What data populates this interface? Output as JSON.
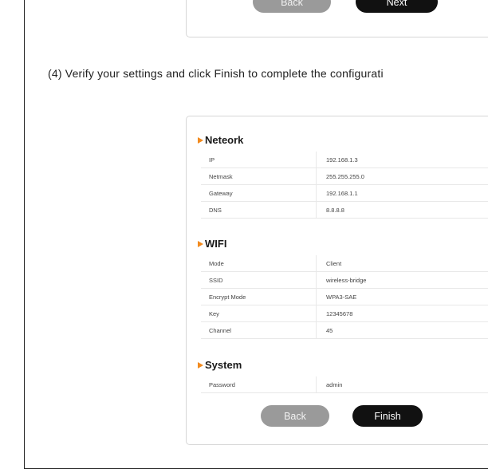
{
  "top_card": {
    "back_label": "Back",
    "next_label": "Next"
  },
  "instruction": "(4) Verify your settings and click Finish to complete the configurati",
  "network": {
    "title": "Neteork",
    "rows": [
      {
        "label": "IP",
        "value": "192.168.1.3"
      },
      {
        "label": "Netmask",
        "value": "255.255.255.0"
      },
      {
        "label": "Gateway",
        "value": "192.168.1.1"
      },
      {
        "label": "DNS",
        "value": "8.8.8.8"
      }
    ]
  },
  "wifi": {
    "title": "WIFI",
    "rows": [
      {
        "label": "Mode",
        "value": "Client"
      },
      {
        "label": "SSID",
        "value": "wireless-bridge"
      },
      {
        "label": "Encrypt Mode",
        "value": "WPA3-SAE"
      },
      {
        "label": "Key",
        "value": "12345678"
      },
      {
        "label": "Channel",
        "value": "45"
      }
    ]
  },
  "system": {
    "title": "System",
    "rows": [
      {
        "label": "Password",
        "value": "admin"
      }
    ]
  },
  "buttons": {
    "back_label": "Back",
    "finish_label": "Finish"
  },
  "colors": {
    "section_marker": "#f28a1e",
    "primary_button": "#111111",
    "secondary_button": "#9a9a9a"
  },
  "icons": {
    "section_marker": "triangle-right-icon"
  }
}
